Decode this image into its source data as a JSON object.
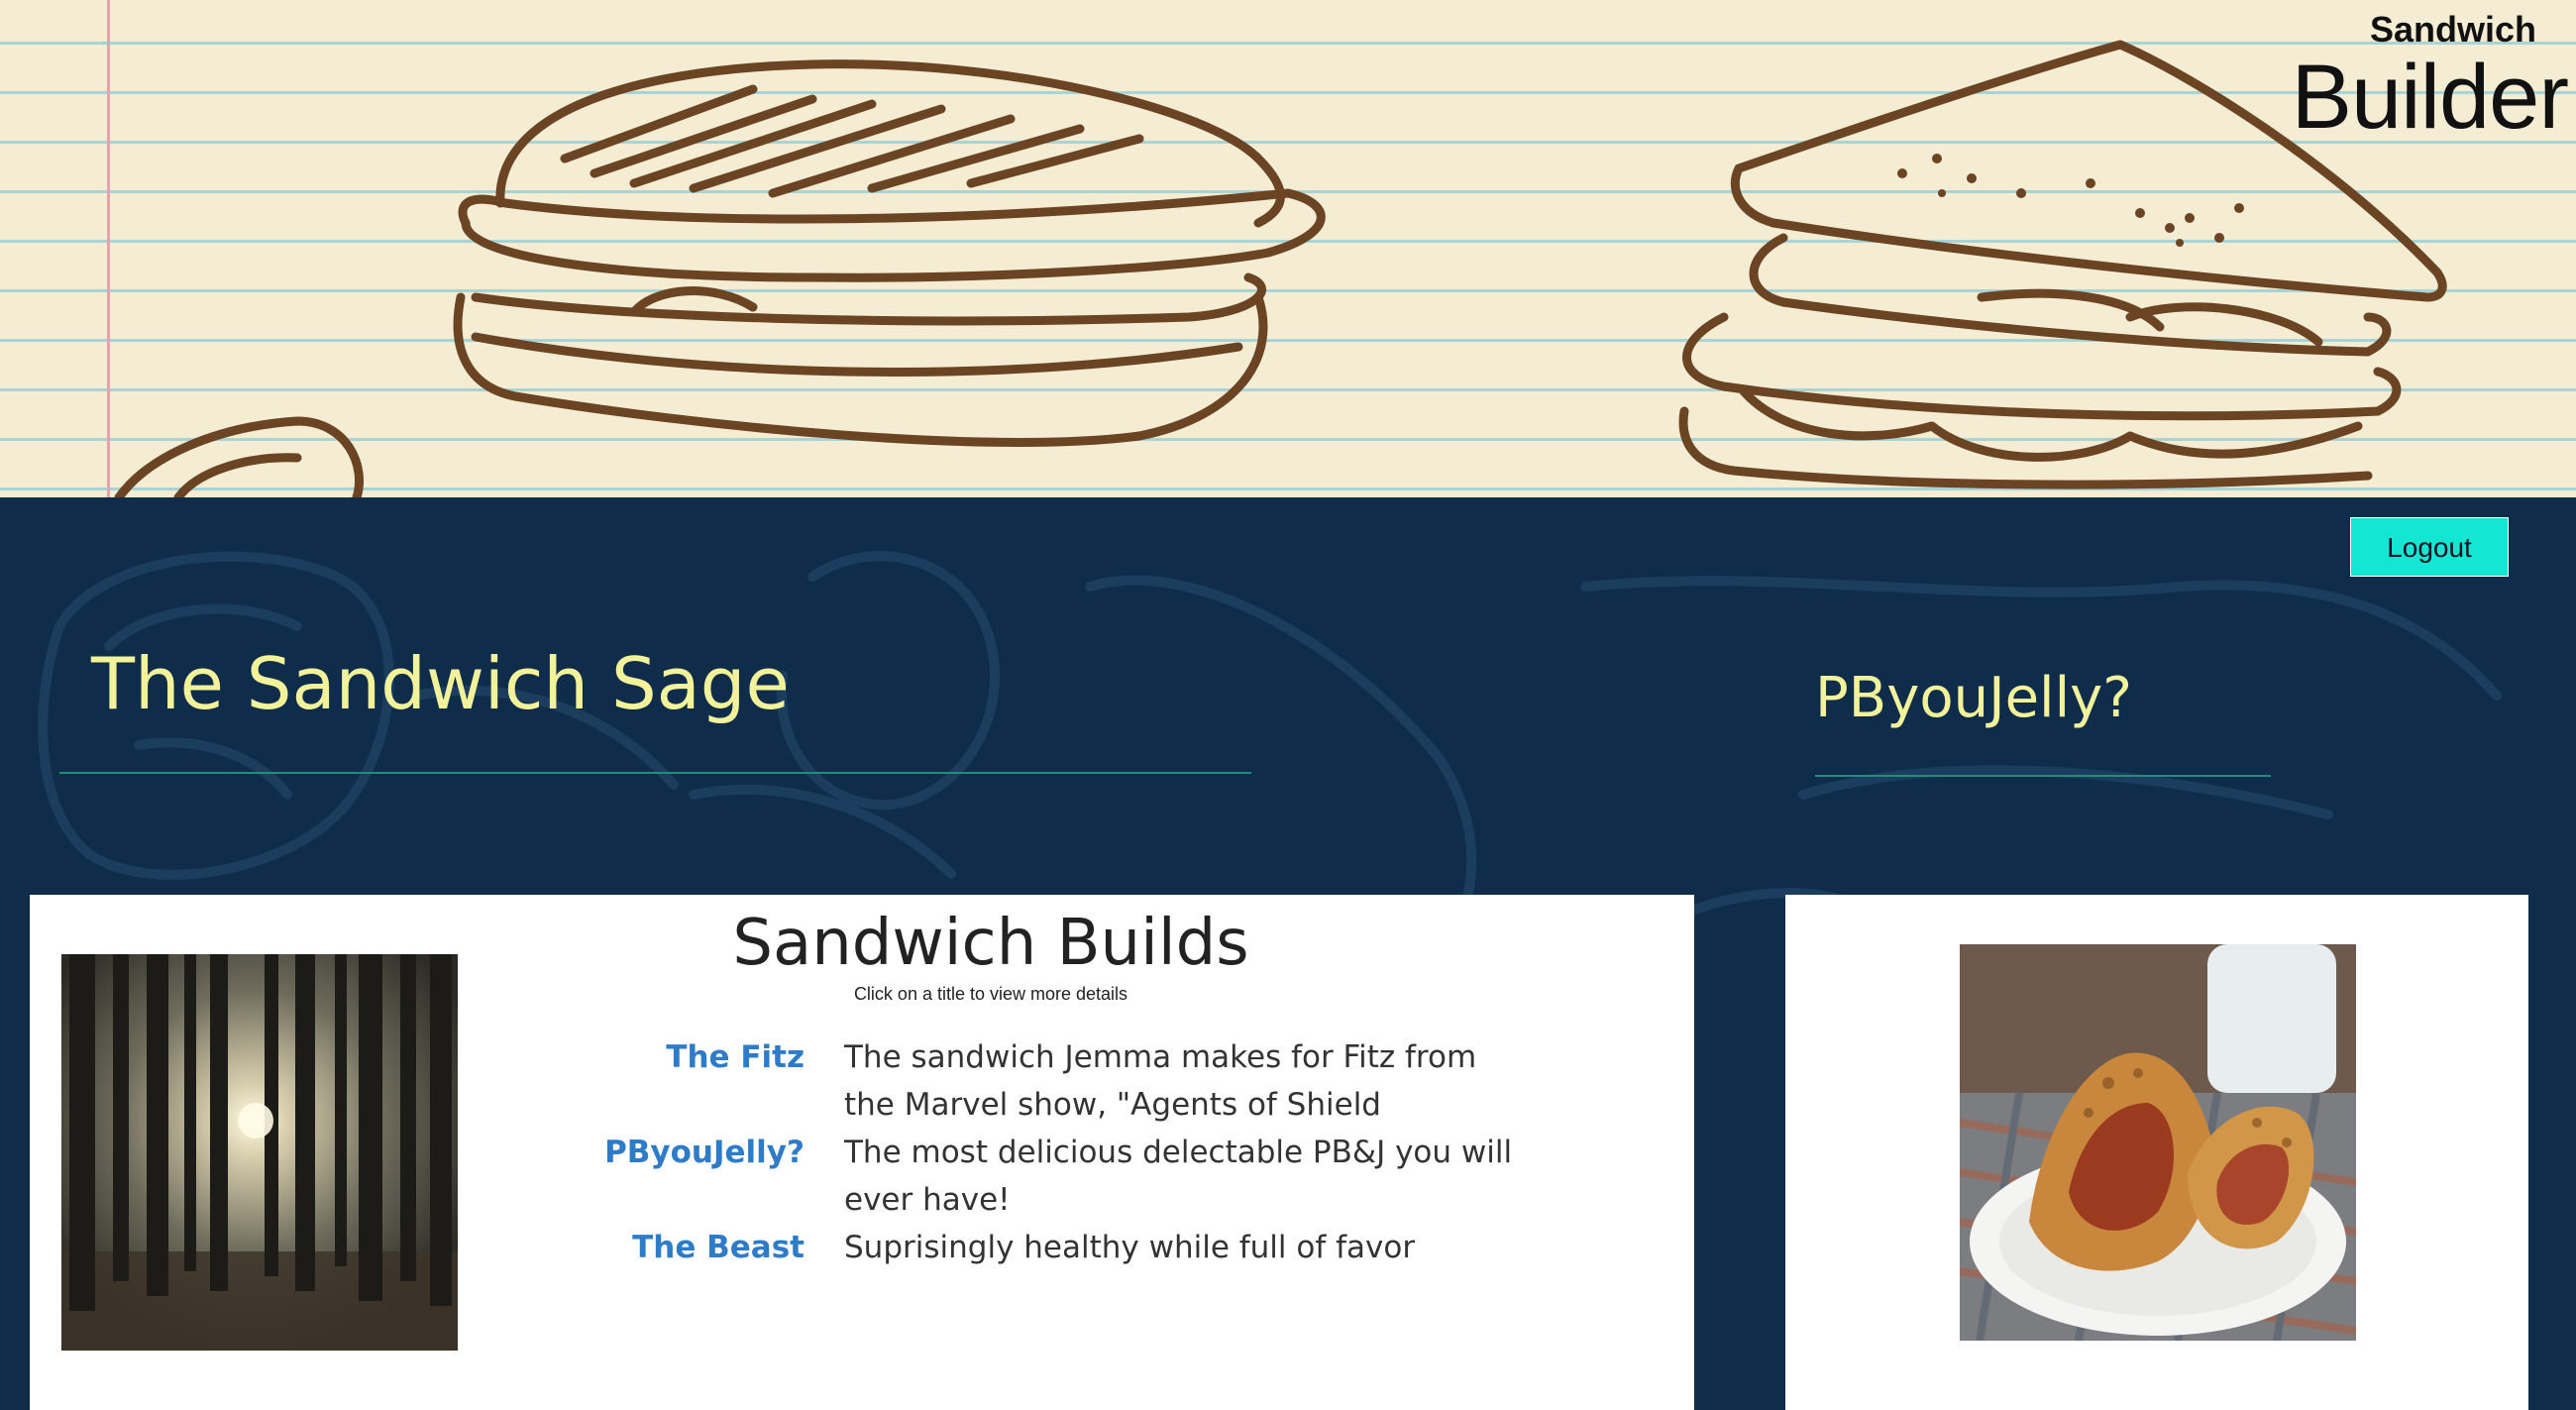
{
  "brand": {
    "line1": "Sandwich",
    "line2": "Builder"
  },
  "logout_label": "Logout",
  "sage_title": "The Sandwich Sage",
  "featured_title": "PByouJelly?",
  "builds": {
    "title": "Sandwich Builds",
    "subtitle": "Click on a title to view more details",
    "items": [
      {
        "name": "The Fitz",
        "description": "The sandwich Jemma makes for Fitz from the Marvel show, \"Agents of Shield"
      },
      {
        "name": "PByouJelly?",
        "description": "The most delicious delectable PB&J you will ever have!"
      },
      {
        "name": "The Beast",
        "description": "Suprisingly healthy while full of favor"
      }
    ]
  },
  "colors": {
    "paper": "#f4edd4",
    "paper_lines": "#a9d4d6",
    "doodle_brown": "#6b4424",
    "navy": "#0f2d4b",
    "title_yellow": "#f2f29a",
    "rule_teal": "#1d8f7a",
    "logout_cyan": "#13e6d2",
    "link_blue": "#2e7cc7"
  },
  "icons": [
    "panini-doodle",
    "club-sandwich-doodle",
    "forest-photo",
    "grilled-sandwich-photo"
  ]
}
